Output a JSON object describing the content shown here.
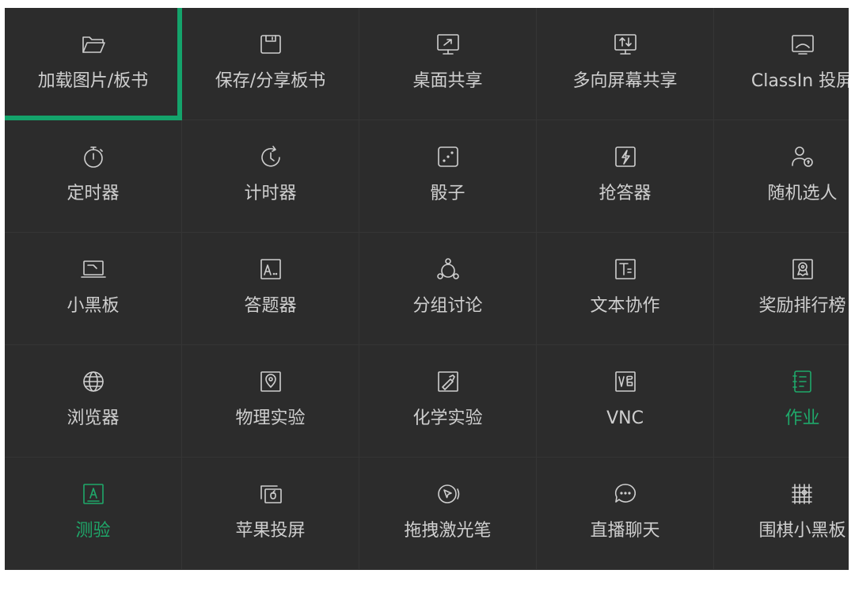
{
  "tools": [
    {
      "label": "加载图片/板书",
      "icon": "folder-icon"
    },
    {
      "label": "保存/分享板书",
      "icon": "save-icon"
    },
    {
      "label": "桌面共享",
      "icon": "screen-share-icon"
    },
    {
      "label": "多向屏幕共享",
      "icon": "multi-screen-share-icon"
    },
    {
      "label": "ClassIn 投屏",
      "icon": "cast-icon"
    },
    {
      "label": "定时器",
      "icon": "timer-icon"
    },
    {
      "label": "计时器",
      "icon": "stopwatch-icon"
    },
    {
      "label": "骰子",
      "icon": "dice-icon"
    },
    {
      "label": "抢答器",
      "icon": "buzzer-icon"
    },
    {
      "label": "随机选人",
      "icon": "random-user-icon"
    },
    {
      "label": "小黑板",
      "icon": "small-blackboard-icon"
    },
    {
      "label": "答题器",
      "icon": "answer-sheet-icon"
    },
    {
      "label": "分组讨论",
      "icon": "group-discussion-icon"
    },
    {
      "label": "文本协作",
      "icon": "text-collaboration-icon"
    },
    {
      "label": "奖励排行榜",
      "icon": "award-ranking-icon"
    },
    {
      "label": "浏览器",
      "icon": "globe-icon"
    },
    {
      "label": "物理实验",
      "icon": "physics-lab-icon"
    },
    {
      "label": "化学实验",
      "icon": "chemistry-lab-icon"
    },
    {
      "label": "VNC",
      "icon": "vnc-icon"
    },
    {
      "label": "作业",
      "icon": "homework-icon"
    },
    {
      "label": "测验",
      "icon": "quiz-icon"
    },
    {
      "label": "苹果投屏",
      "icon": "apple-cast-icon"
    },
    {
      "label": "拖拽激光笔",
      "icon": "laser-pointer-icon"
    },
    {
      "label": "直播聊天",
      "icon": "live-chat-icon"
    },
    {
      "label": "围棋小黑板",
      "icon": "go-board-icon"
    }
  ],
  "colors": {
    "panel_bg": "#2c2c2c",
    "text": "#cfcfcf",
    "accent_green": "#1fa86a",
    "selection_border": "#14a36b"
  },
  "state": {
    "selected": "加载图片/板书",
    "highlighted": [
      "作业",
      "测验"
    ]
  }
}
